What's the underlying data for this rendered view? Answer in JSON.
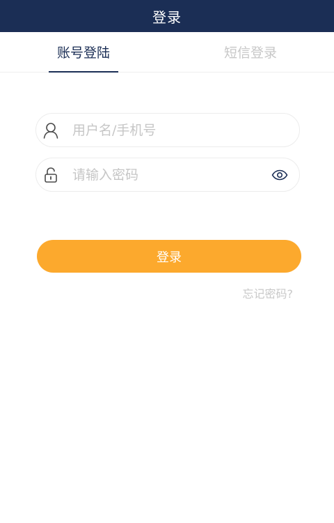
{
  "header": {
    "title": "登录"
  },
  "tabs": [
    {
      "label": "账号登陆",
      "active": true
    },
    {
      "label": "短信登录",
      "active": false
    }
  ],
  "form": {
    "username": {
      "placeholder": "用户名/手机号",
      "value": "",
      "icon": "user-icon"
    },
    "password": {
      "placeholder": "请输入密码",
      "value": "",
      "icon": "lock-icon",
      "toggle_icon": "eye-icon"
    },
    "login_label": "登录",
    "forgot_label": "忘记密码?"
  },
  "colors": {
    "header_bg": "#1b2e55",
    "accent": "#fca92d",
    "active_tab": "#1b2e55",
    "inactive_tab": "#c7c7c7"
  }
}
